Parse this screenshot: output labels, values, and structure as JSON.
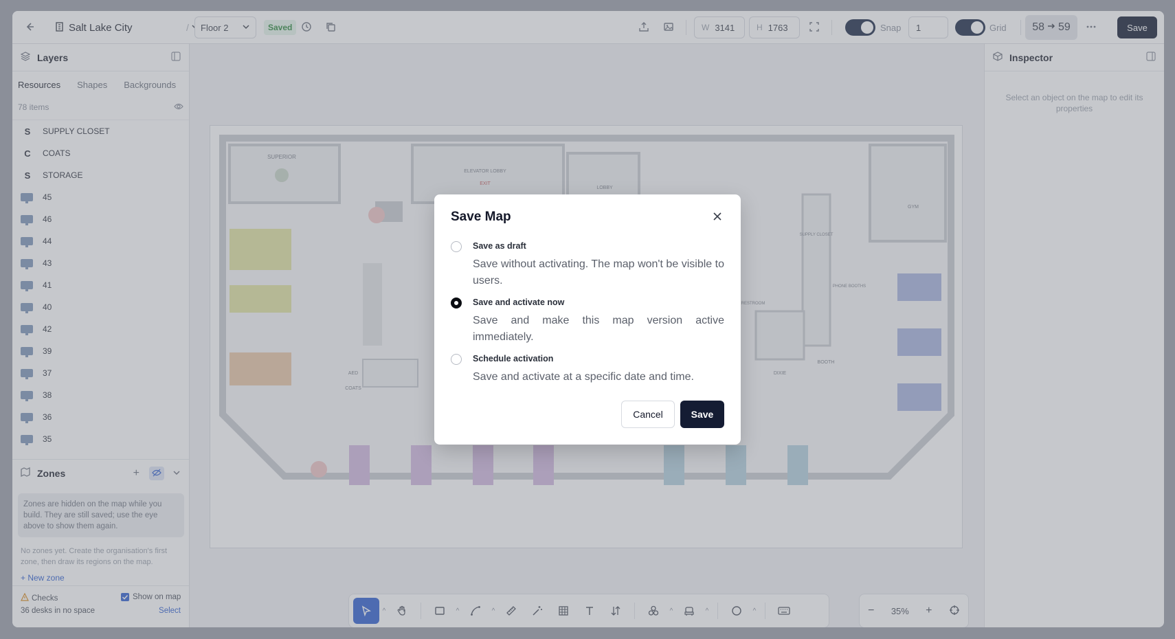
{
  "topbar": {
    "location": "Salt Lake City",
    "floor": "Floor 2",
    "status": "Saved",
    "width_label": "W",
    "width_value": "3141",
    "height_label": "H",
    "height_value": "1763",
    "snap_label": "Snap",
    "snap_value": "1",
    "grid_label": "Grid",
    "version_from": "58",
    "version_to": "59",
    "save_label": "Save"
  },
  "layers": {
    "title": "Layers",
    "tabs": [
      "Resources",
      "Shapes",
      "Backgrounds"
    ],
    "count": "78 items",
    "items": [
      {
        "prefix": "S",
        "label": "SUPPLY CLOSET"
      },
      {
        "prefix": "C",
        "label": "COATS"
      },
      {
        "prefix": "S",
        "label": "STORAGE"
      },
      {
        "label": "45"
      },
      {
        "label": "46"
      },
      {
        "label": "44"
      },
      {
        "label": "43"
      },
      {
        "label": "41"
      },
      {
        "label": "40"
      },
      {
        "label": "42"
      },
      {
        "label": "39"
      },
      {
        "label": "37"
      },
      {
        "label": "38"
      },
      {
        "label": "36"
      },
      {
        "label": "35"
      }
    ]
  },
  "zones": {
    "title": "Zones",
    "note": "Zones are hidden on the map while you build. They are still saved; use the eye above to show them again.",
    "empty": "No zones yet. Create the organisation's first zone, then draw its regions on the map.",
    "new_zone": "New zone"
  },
  "checks": {
    "title": "Checks",
    "show_on_map": "Show on map",
    "summary": "36 desks in no space",
    "select": "Select"
  },
  "inspector": {
    "title": "Inspector",
    "hint": "Select an object on the map to edit its properties"
  },
  "map_labels": {
    "superior": "SUPERIOR",
    "elevator": "ELEVATOR LOBBY",
    "exit": "EXIT",
    "lobby": "LOBBY",
    "gym": "GYM",
    "supply": "SUPPLY CLOSET",
    "phone": "PHONE BOOTHS",
    "restroom": "RESTROOM",
    "booth": "BOOTH",
    "dixie": "DIXIE",
    "aed": "AED",
    "coats": "COATS"
  },
  "zoom": {
    "value": "35%"
  },
  "modal": {
    "title": "Save Map",
    "options": [
      {
        "label": "Save as draft",
        "desc": "Save without activating. The map won't be visible to users.",
        "checked": false
      },
      {
        "label": "Save and activate now",
        "desc": "Save and make this map version active immediately.",
        "checked": true
      },
      {
        "label": "Schedule activation",
        "desc": "Save and activate at a specific date and time.",
        "checked": false
      }
    ],
    "cancel": "Cancel",
    "save": "Save"
  },
  "colors": {
    "primary": "#141c33",
    "accent": "#2f5fd0",
    "saved_green": "#2e8a3e"
  }
}
